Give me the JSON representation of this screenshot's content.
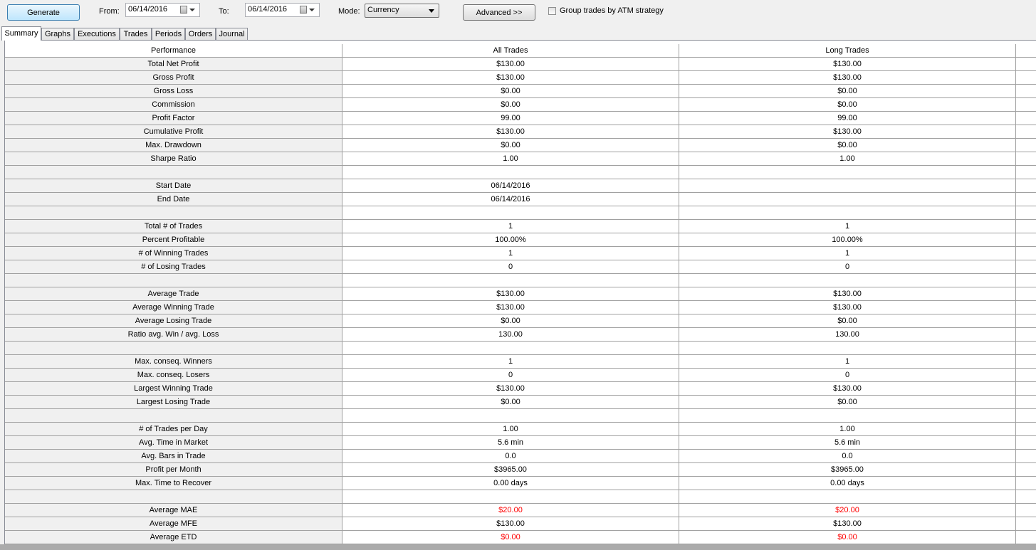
{
  "toolbar": {
    "generate_label": "Generate",
    "from_label": "From:",
    "from_value": "06/14/2016",
    "to_label": "To:",
    "to_value": "06/14/2016",
    "mode_label": "Mode:",
    "mode_value": "Currency",
    "advanced_label": "Advanced >>",
    "group_label": "Group trades by ATM strategy",
    "group_checked": false
  },
  "tabs": [
    {
      "label": "Summary",
      "active": true
    },
    {
      "label": "Graphs",
      "active": false
    },
    {
      "label": "Executions",
      "active": false
    },
    {
      "label": "Trades",
      "active": false
    },
    {
      "label": "Periods",
      "active": false
    },
    {
      "label": "Orders",
      "active": false
    },
    {
      "label": "Journal",
      "active": false
    }
  ],
  "table": {
    "headers": [
      "Performance",
      "All Trades",
      "Long Trades",
      ""
    ],
    "rows": [
      [
        "Total Net Profit",
        "$130.00",
        "$130.00"
      ],
      [
        "Gross Profit",
        "$130.00",
        "$130.00"
      ],
      [
        "Gross Loss",
        "$0.00",
        "$0.00"
      ],
      [
        "Commission",
        "$0.00",
        "$0.00"
      ],
      [
        "Profit Factor",
        "99.00",
        "99.00"
      ],
      [
        "Cumulative Profit",
        "$130.00",
        "$130.00"
      ],
      [
        "Max. Drawdown",
        "$0.00",
        "$0.00"
      ],
      [
        "Sharpe Ratio",
        "1.00",
        "1.00"
      ],
      [
        "",
        "",
        ""
      ],
      [
        "Start Date",
        "06/14/2016",
        ""
      ],
      [
        "End Date",
        "06/14/2016",
        ""
      ],
      [
        "",
        "",
        ""
      ],
      [
        "Total # of Trades",
        "1",
        "1"
      ],
      [
        "Percent Profitable",
        "100.00%",
        "100.00%"
      ],
      [
        "# of Winning Trades",
        "1",
        "1"
      ],
      [
        "# of Losing Trades",
        "0",
        "0"
      ],
      [
        "",
        "",
        ""
      ],
      [
        "Average Trade",
        "$130.00",
        "$130.00"
      ],
      [
        "Average Winning Trade",
        "$130.00",
        "$130.00"
      ],
      [
        "Average Losing Trade",
        "$0.00",
        "$0.00"
      ],
      [
        "Ratio avg. Win / avg. Loss",
        "130.00",
        "130.00"
      ],
      [
        "",
        "",
        ""
      ],
      [
        "Max. conseq. Winners",
        "1",
        "1"
      ],
      [
        "Max. conseq. Losers",
        "0",
        "0"
      ],
      [
        "Largest Winning Trade",
        "$130.00",
        "$130.00"
      ],
      [
        "Largest Losing Trade",
        "$0.00",
        "$0.00"
      ],
      [
        "",
        "",
        ""
      ],
      [
        "# of Trades per Day",
        "1.00",
        "1.00"
      ],
      [
        "Avg. Time in Market",
        "5.6 min",
        "5.6 min"
      ],
      [
        "Avg. Bars in Trade",
        "0.0",
        "0.0"
      ],
      [
        "Profit per Month",
        "$3965.00",
        "$3965.00"
      ],
      [
        "Max. Time to Recover",
        "0.00 days",
        "0.00 days"
      ],
      [
        "",
        "",
        ""
      ],
      [
        "Average MAE",
        "$20.00",
        "$20.00"
      ],
      [
        "Average MFE",
        "$130.00",
        "$130.00"
      ],
      [
        "Average ETD",
        "$0.00",
        "$0.00"
      ]
    ],
    "red_rows": [
      33,
      35
    ],
    "negative_color": "#ff0000"
  }
}
